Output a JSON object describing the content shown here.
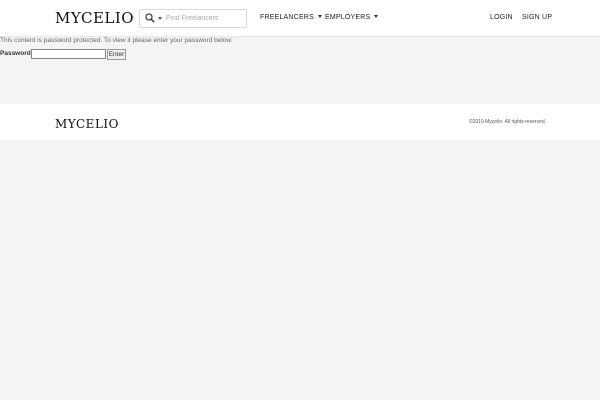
{
  "header": {
    "logo": "MYCELIO",
    "search": {
      "placeholder": "Find Freelancers",
      "icon": "search-icon"
    },
    "nav": {
      "freelancers": "FREELANCERS",
      "employers": "EMPLOYERS",
      "login": "LOGIN",
      "signup": "SIGN UP"
    }
  },
  "main": {
    "message": "This content is password protected. To view it please enter your password below:",
    "password_label": "Password:",
    "submit_label": "Enter"
  },
  "footer": {
    "logo": "MYCELIO",
    "copyright": "©2019 Mycelio. All rights reserved."
  },
  "colors": {
    "page_bg": "#f4f4f4",
    "header_bg": "#ffffff",
    "text": "#222222"
  }
}
